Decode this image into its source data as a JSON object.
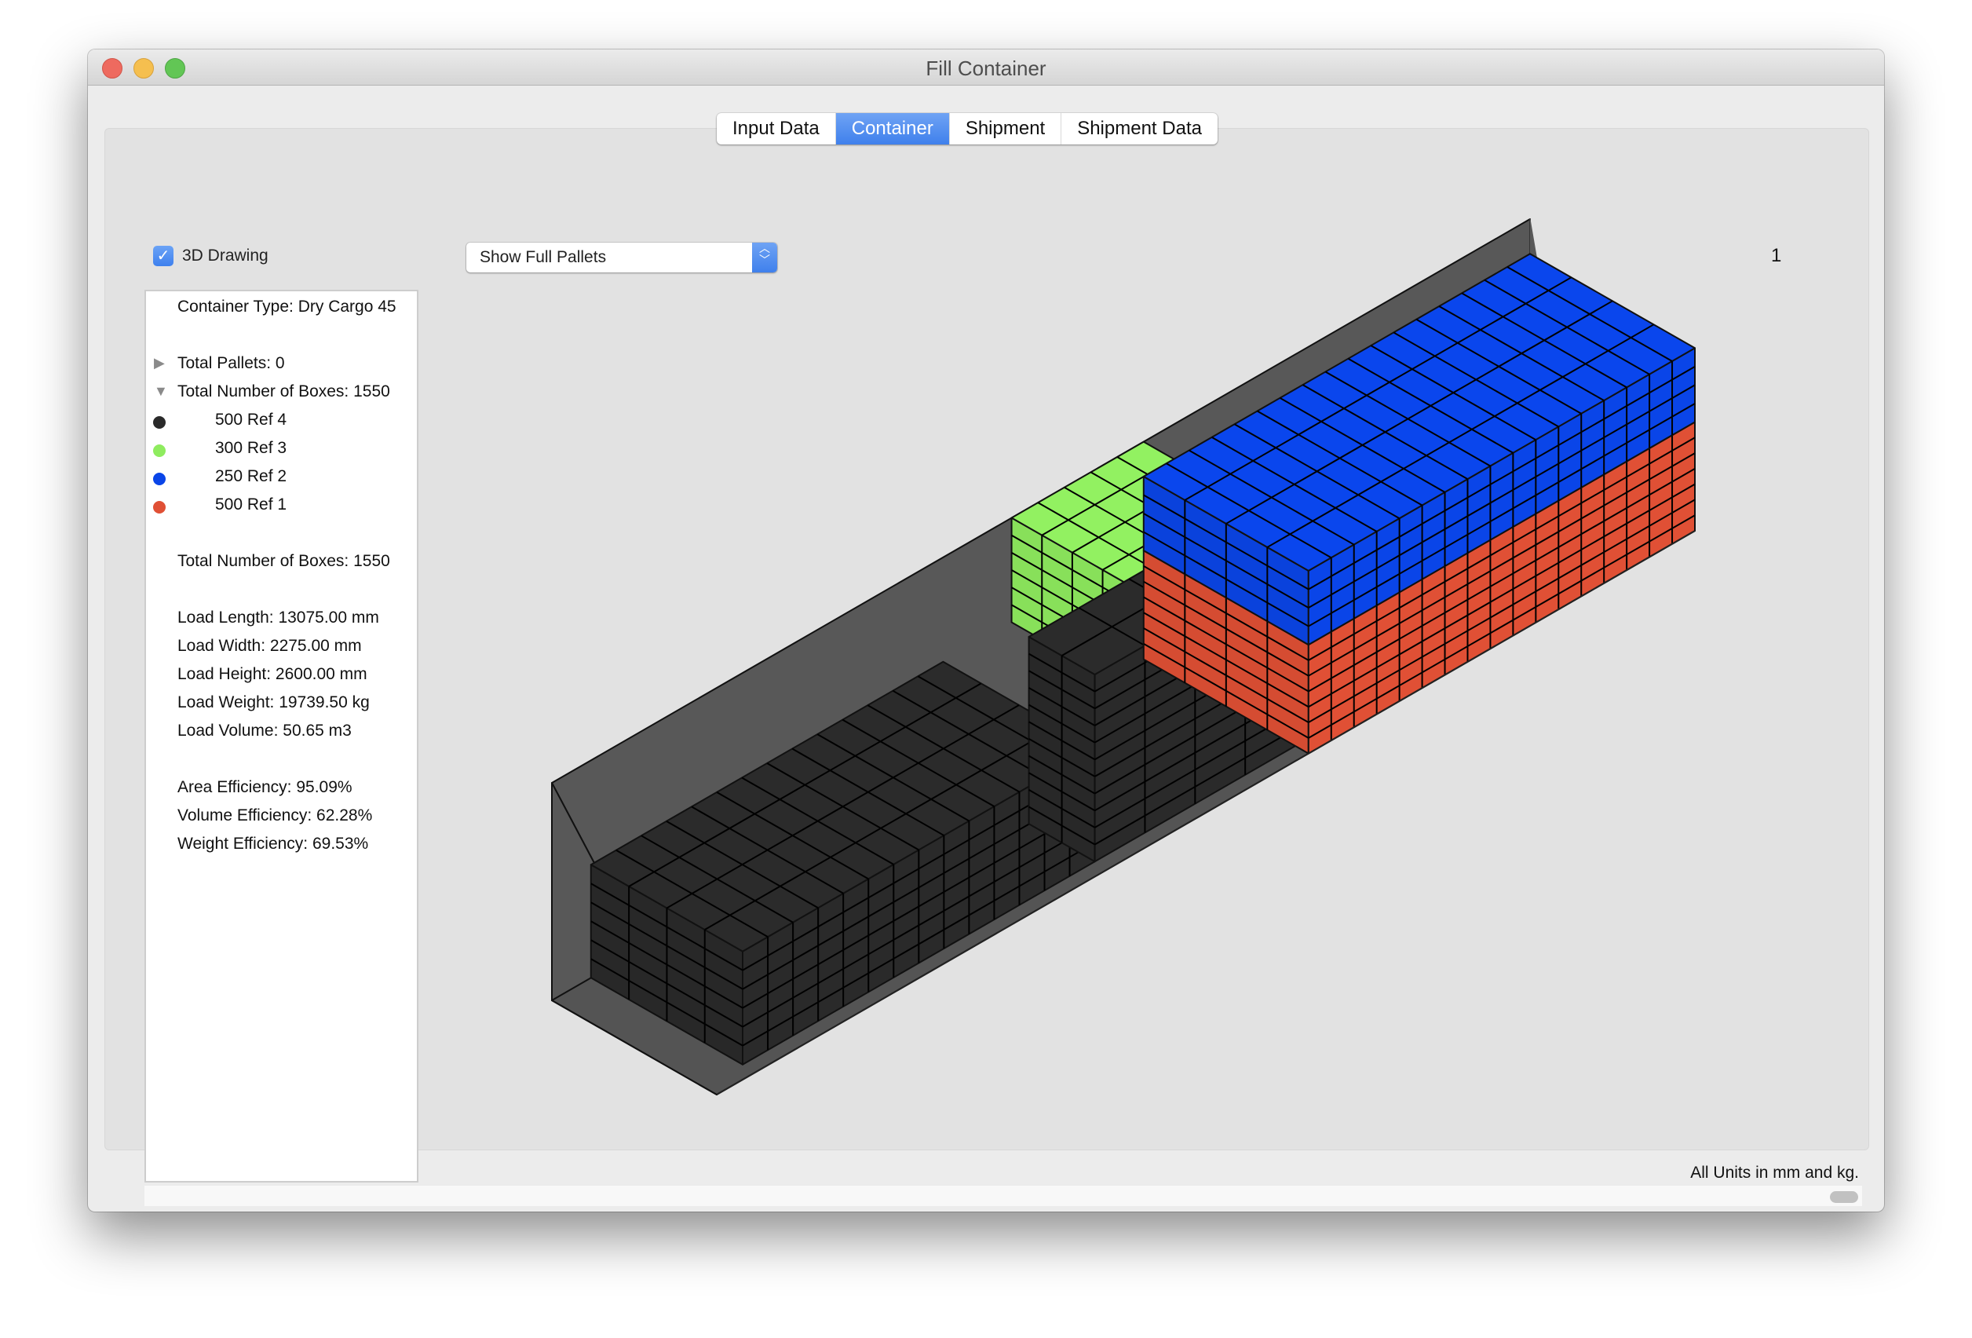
{
  "window": {
    "title": "Fill Container"
  },
  "tabs": [
    {
      "label": "Input Data",
      "active": false
    },
    {
      "label": "Container",
      "active": true
    },
    {
      "label": "Shipment",
      "active": false
    },
    {
      "label": "Shipment Data",
      "active": false
    }
  ],
  "drawing_toggle": {
    "label": "3D Drawing",
    "checked": true
  },
  "view_select": {
    "selected": "Show Full Pallets"
  },
  "page_number": "1",
  "info": {
    "container_type": "Container Type: Dry Cargo 45",
    "total_pallets": "Total Pallets: 0",
    "total_boxes_header": "Total Number of Boxes: 1550",
    "items": [
      {
        "label": "500 Ref 4",
        "color": "#2a2a2a"
      },
      {
        "label": "300 Ref 3",
        "color": "#8fec5f"
      },
      {
        "label": "250 Ref 2",
        "color": "#0a45e8"
      },
      {
        "label": "500 Ref 1",
        "color": "#e05035"
      }
    ],
    "total_boxes": "Total Number of Boxes: 1550",
    "load_length": "Load Length: 13075.00 mm",
    "load_width": "Load Width: 2275.00 mm",
    "load_height": "Load Height: 2600.00 mm",
    "load_weight": "Load Weight: 19739.50 kg",
    "load_volume": "Load Volume: 50.65 m3",
    "area_efficiency": "Area Efficiency: 95.09%",
    "volume_efficiency": "Volume Efficiency: 62.28%",
    "weight_efficiency": "Weight Efficiency: 69.53%"
  },
  "scene": {
    "wall_color": "#585858",
    "outline_color": "#111111",
    "blocks": [
      {
        "name": "ref4-floor-block",
        "ref": "500 Ref 4",
        "color": "#2a2a2a",
        "l": [
          0.04,
          0.4
        ],
        "w": [
          0.0,
          0.92
        ],
        "h": [
          0.0,
          0.52
        ],
        "nl": 14,
        "nw": 4,
        "nh": 6
      },
      {
        "name": "ref3-block",
        "ref": "300 Ref 3",
        "color": "#8fec5f",
        "l": [
          0.47,
          0.605
        ],
        "w": [
          0.0,
          0.92
        ],
        "h": [
          0.52,
          1.0
        ],
        "nl": 5,
        "nw": 5,
        "nh": 6
      },
      {
        "name": "ref4-tall-block",
        "ref": "500 Ref 4",
        "color": "#2a2a2a",
        "l": [
          0.4,
          0.605
        ],
        "w": [
          0.52,
          0.92
        ],
        "h": [
          0.0,
          0.86
        ],
        "nl": 4,
        "nw": 2,
        "nh": 11
      },
      {
        "name": "ref1-block",
        "ref": "500 Ref 1",
        "color": "#e05035",
        "l": [
          0.605,
          1.0
        ],
        "w": [
          0.0,
          1.0
        ],
        "h": [
          0.0,
          0.5
        ],
        "nl": 17,
        "nw": 4,
        "nh": 7
      },
      {
        "name": "ref2-block",
        "ref": "250 Ref 2",
        "color": "#0a45e8",
        "l": [
          0.605,
          1.0
        ],
        "w": [
          0.0,
          1.0
        ],
        "h": [
          0.5,
          0.84
        ],
        "nl": 17,
        "nw": 4,
        "nh": 4
      }
    ]
  },
  "footer_note": "All Units in mm and kg."
}
